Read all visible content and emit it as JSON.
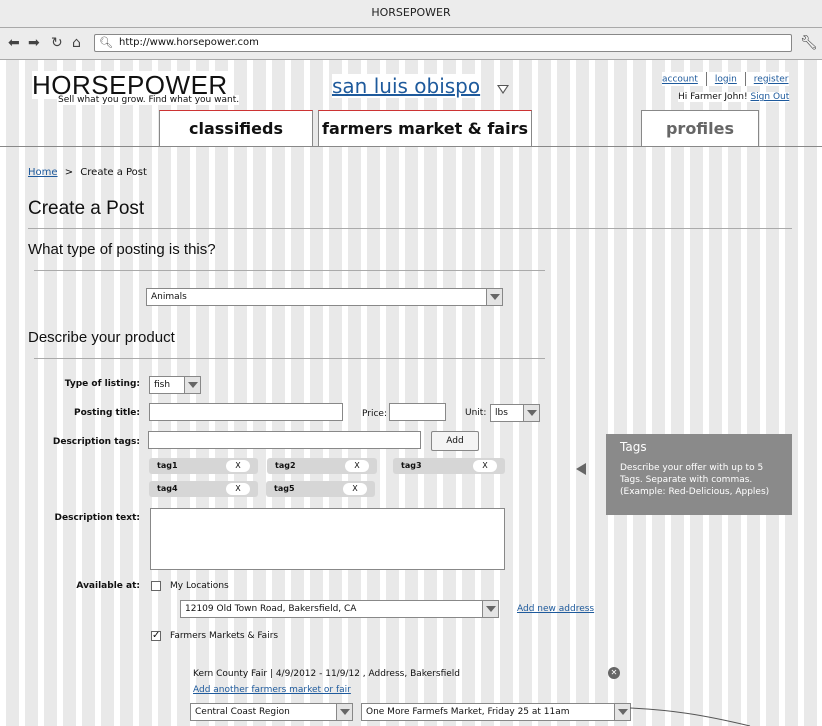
{
  "window": {
    "title": "HORSEPOWER"
  },
  "browser": {
    "url": "http://www.horsepower.com"
  },
  "header": {
    "logo": "HORSEPOWER",
    "tagline": "Sell what you grow. Find what you want.",
    "city": "san luis obispo",
    "links": {
      "account": "account",
      "login": "login",
      "register": "register"
    },
    "greeting": "Hi Farmer John!",
    "signout": "Sign Out"
  },
  "nav": {
    "classifieds": "classifieds",
    "farmers": "farmers market & fairs",
    "profiles": "profiles"
  },
  "breadcrumb": {
    "home": "Home",
    "sep": ">",
    "current": "Create a Post"
  },
  "page": {
    "title": "Create a Post"
  },
  "section1": {
    "heading": "What type of posting is this?",
    "category_value": "Animals"
  },
  "section2": {
    "heading": "Describe your product"
  },
  "form": {
    "type_label": "Type of listing:",
    "type_value": "fish",
    "title_label": "Posting title:",
    "price_label": "Price:",
    "unit_label": "Unit:",
    "unit_value": "lbs",
    "tags_label": "Description tags:",
    "add_label": "Add",
    "tags": [
      "tag1",
      "tag2",
      "tag3",
      "tag4",
      "tag5"
    ],
    "tag_remove": "X",
    "desc_label": "Description text:",
    "avail_label": "Available at:",
    "my_locations": "My Locations",
    "address_value": "12109 Old Town Road, Bakersfield, CA",
    "add_address": "Add new address",
    "farmers_markets": "Farmers Markets & Fairs",
    "event_line": "Kern County Fair | 4/9/2012 - 11/9/12 , Address, Bakersfield",
    "add_market": "Add another farmers market or fair",
    "region_value": "Central Coast Region",
    "market_value": "One More Farmefs Market, Friday 25 at 11am"
  },
  "tooltip": {
    "title": "Tags",
    "text": "Describe your offer with up to 5 Tags. Separate with commas. (Example: Red-Delicious, Apples)"
  }
}
